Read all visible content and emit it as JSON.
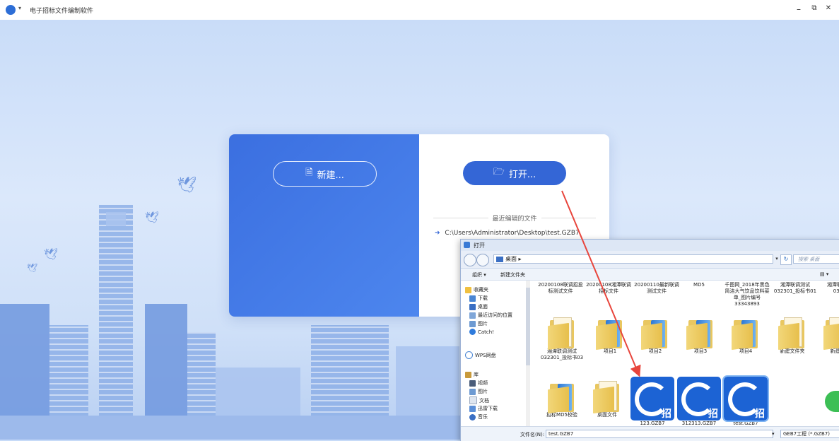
{
  "app": {
    "title": "电子招标文件编制软件",
    "title_caret": "▾",
    "minimize_icon": "–",
    "restore_icon": "⧉",
    "close_icon": "✕"
  },
  "card": {
    "new_button": "新建...",
    "open_button": "打开...",
    "recent_heading": "最近编辑的文件",
    "recent_files": [
      "C:\\Users\\Administrator\\Desktop\\test.GZB7"
    ]
  },
  "dialog": {
    "title": "打开",
    "address": "桌面",
    "address_caret": "▸",
    "search_placeholder": "搜索 桌面",
    "toolbar": {
      "organize": "组织 ▾",
      "new_folder": "新建文件夹"
    },
    "sidebar": [
      {
        "label": "收藏夹",
        "icon": "star-icon"
      },
      {
        "label": "下载",
        "icon": "download-icon"
      },
      {
        "label": "桌面",
        "icon": "desktop-icon"
      },
      {
        "label": "最近访问的位置",
        "icon": "recent-icon"
      },
      {
        "label": "图片",
        "icon": "picture-icon"
      },
      {
        "label": "Catch!",
        "icon": "catch-icon"
      },
      {
        "label": "WPS网盘",
        "icon": "cloud-icon"
      },
      {
        "label": "库",
        "icon": "library-icon"
      },
      {
        "label": "视频",
        "icon": "video-icon"
      },
      {
        "label": "图片",
        "icon": "picture-icon"
      },
      {
        "label": "文档",
        "icon": "document-icon"
      },
      {
        "label": "迅雷下载",
        "icon": "thunder-icon"
      },
      {
        "label": "音乐",
        "icon": "music-icon"
      }
    ],
    "top_row": [
      "20200108联调招投标测试文件",
      "20200108湘潭联调招标文件",
      "20200110最新联调测试文件",
      "MD5",
      "千图网_2018年黑色简洁大气饮品饮料菜单_图片编号33343893",
      "湘潭联调测试032301_投标书01",
      "湘潭联调测试0323..."
    ],
    "middle_row": [
      "湘潭联调测试032301_投标书03",
      "项目1",
      "项目2",
      "项目3",
      "项目4",
      "新建文件夹",
      "新建..."
    ],
    "bottom_row": [
      "招标MD5校验",
      "桌面文件",
      "123.GZB7",
      "312313.GZB7",
      "test.GZB7"
    ],
    "gzb_char": "招",
    "filename_label": "文件名(N):",
    "filename_value": "test.GZB7",
    "filetype_value": "GEB7工程 (*.GZB7)"
  },
  "colors": {
    "accent": "#3466d6",
    "card_left": "#4d86ee",
    "arrow": "#e8453c"
  }
}
